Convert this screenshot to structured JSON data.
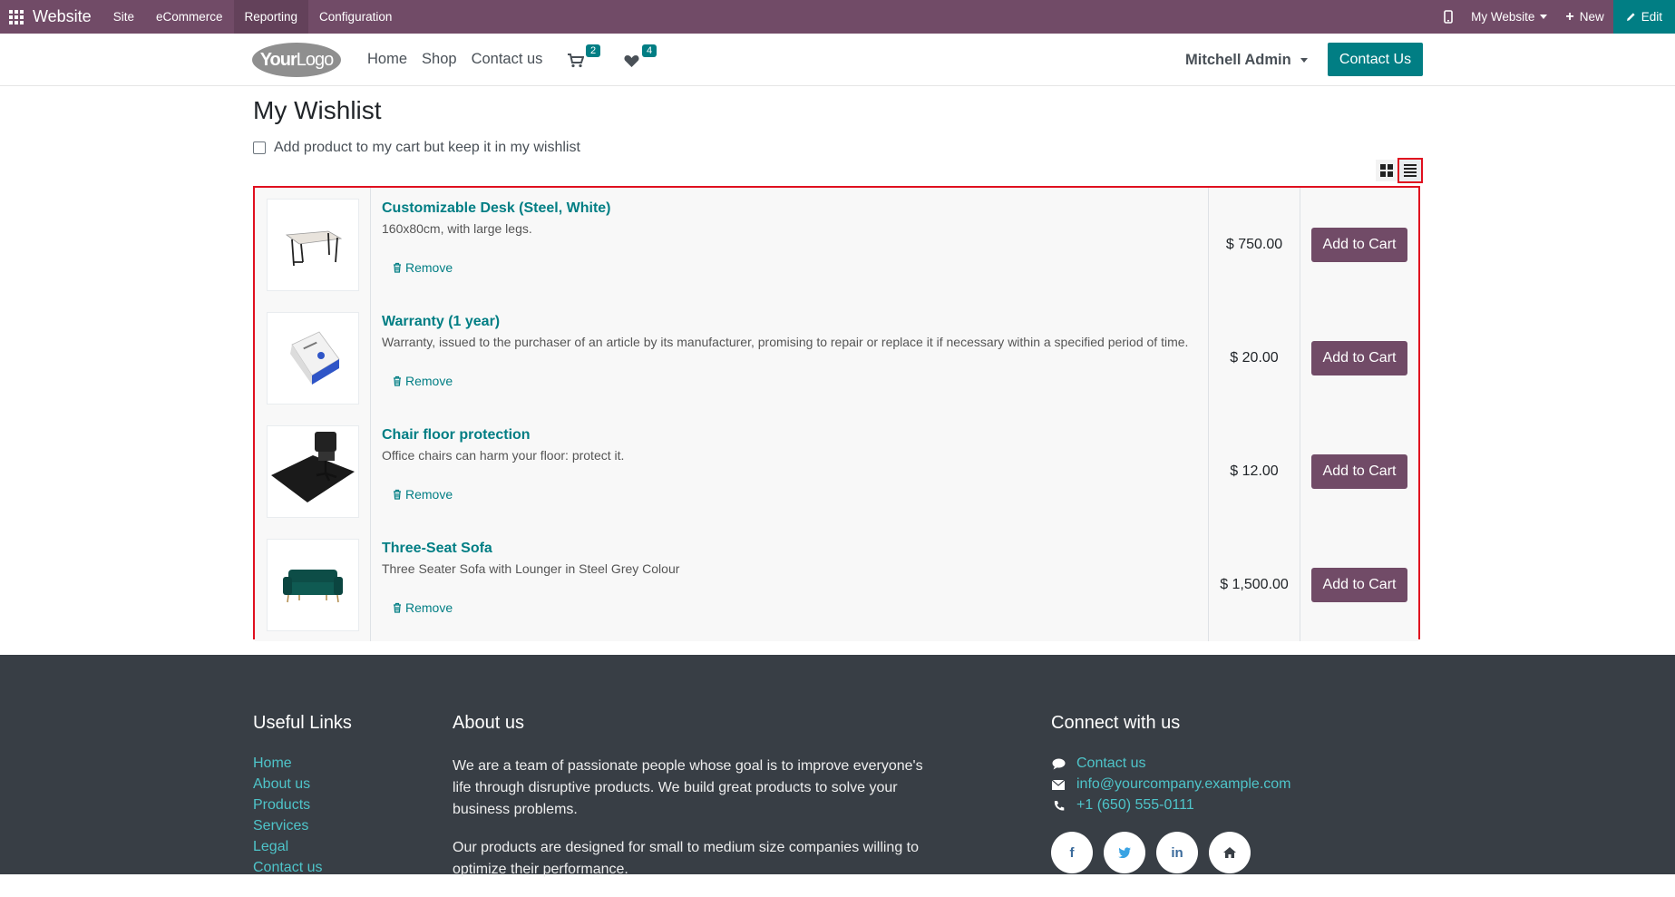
{
  "topbar": {
    "app_name": "Website",
    "menu": [
      "Site",
      "eCommerce",
      "Reporting",
      "Configuration"
    ],
    "website_selector": "My Website",
    "new_label": "New",
    "edit_label": "Edit",
    "bg_color": "#714B67",
    "edit_color": "#017E84"
  },
  "navbar": {
    "logo_bold": "Your",
    "logo_rest": "Logo",
    "links": [
      "Home",
      "Shop",
      "Contact us"
    ],
    "cart_count": "2",
    "wishlist_count": "4",
    "user": "Mitchell Admin",
    "contact_button": "Contact Us"
  },
  "page": {
    "title": "My Wishlist",
    "keep_in_wishlist_label": "Add product to my cart but keep it in my wishlist"
  },
  "wishlist": {
    "remove_label": "Remove",
    "add_to_cart_label": "Add to Cart",
    "items": [
      {
        "name": "Customizable Desk (Steel, White)",
        "description": "160x80cm, with large legs.",
        "price": "$ 750.00",
        "image": "desk-image"
      },
      {
        "name": "Warranty (1 year)",
        "description": "Warranty, issued to the purchaser of an article by its manufacturer, promising to repair or replace it if necessary within a specified period of time.",
        "price": "$ 20.00",
        "image": "warranty-box-image"
      },
      {
        "name": "Chair floor protection",
        "description": "Office chairs can harm your floor: protect it.",
        "price": "$ 12.00",
        "image": "floor-mat-image"
      },
      {
        "name": "Three-Seat Sofa",
        "description": "Three Seater Sofa with Lounger in Steel Grey Colour",
        "price": "$ 1,500.00",
        "image": "sofa-image"
      }
    ]
  },
  "footer": {
    "useful_links_title": "Useful Links",
    "useful_links": [
      "Home",
      "About us",
      "Products",
      "Services",
      "Legal",
      "Contact us"
    ],
    "about_title": "About us",
    "about_p1": "We are a team of passionate people whose goal is to improve everyone's life through disruptive products. We build great products to solve your business problems.",
    "about_p2": "Our products are designed for small to medium size companies willing to optimize their performance.",
    "connect_title": "Connect with us",
    "contact_link": "Contact us",
    "email": "info@yourcompany.example.com",
    "phone": "+1 (650) 555-0111",
    "social": [
      "f",
      "t",
      "in",
      "home"
    ]
  }
}
